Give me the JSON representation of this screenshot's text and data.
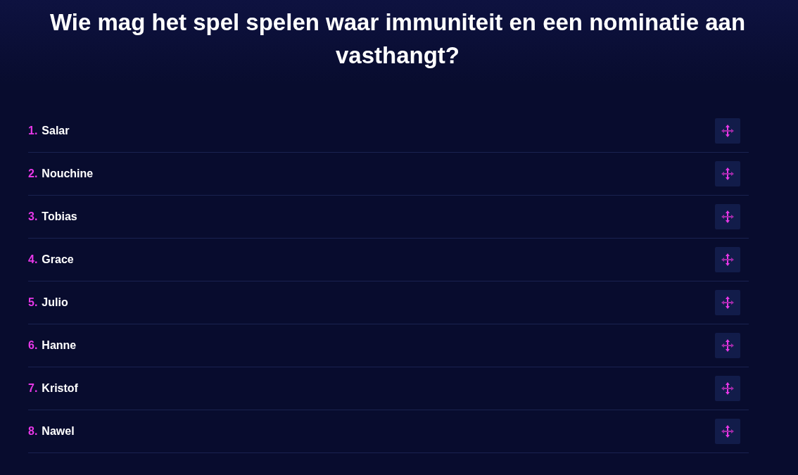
{
  "question": "Wie mag het spel spelen waar immuniteit en een nominatie aan vasthangt?",
  "items": [
    {
      "number": "1.",
      "name": "Salar"
    },
    {
      "number": "2.",
      "name": "Nouchine"
    },
    {
      "number": "3.",
      "name": "Tobias"
    },
    {
      "number": "4.",
      "name": "Grace"
    },
    {
      "number": "5.",
      "name": "Julio"
    },
    {
      "number": "6.",
      "name": "Hanne"
    },
    {
      "number": "7.",
      "name": "Kristof"
    },
    {
      "number": "8.",
      "name": "Nawel"
    }
  ]
}
